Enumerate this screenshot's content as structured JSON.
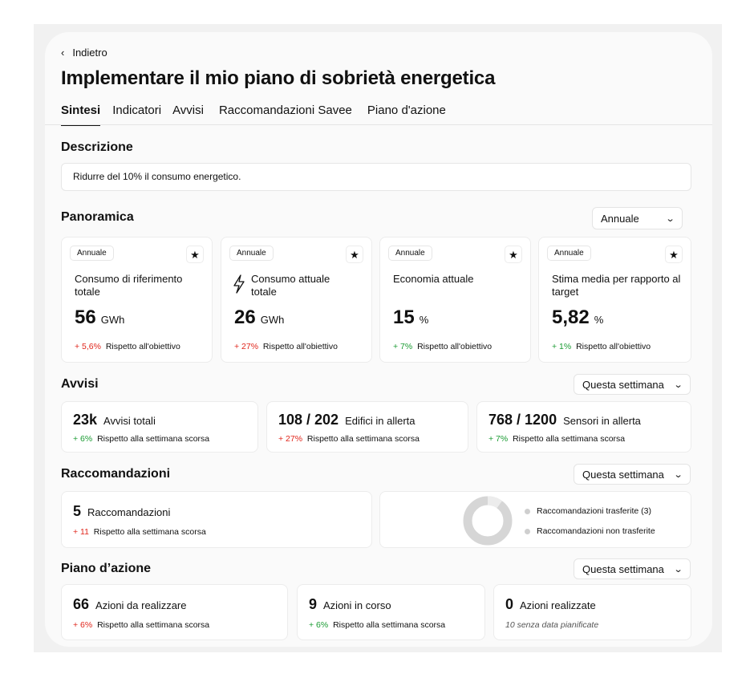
{
  "nav": {
    "back_label": "Indietro"
  },
  "page": {
    "title": "Implementare il mio piano di sobrietà energetica"
  },
  "tabs": [
    {
      "label": "Sintesi",
      "active": true
    },
    {
      "label": "Indicatori"
    },
    {
      "label": "Avvisi"
    },
    {
      "label": "Raccomandazioni Savee"
    },
    {
      "label": "Piano d'azione"
    }
  ],
  "description": {
    "heading": "Descrizione",
    "text": "Ridurre del 10% il consumo energetico."
  },
  "overview": {
    "heading": "Panoramica",
    "period_select": "Annuale",
    "cards": [
      {
        "badge": "Annuale",
        "label": "Consumo di riferimento totale",
        "value": "56",
        "unit": "GWh",
        "delta": "+ 5,6%",
        "delta_note": "Rispetto all'obiettivo",
        "icon": ""
      },
      {
        "badge": "Annuale",
        "label": "Consumo attuale totale",
        "value": "26",
        "unit": "GWh",
        "delta": "+ 27%",
        "delta_note": "Rispetto all'obiettivo",
        "icon": "lightning-icon"
      },
      {
        "badge": "Annuale",
        "label": "Economia attuale",
        "value": "15",
        "unit": "%",
        "delta": "+ 7%",
        "delta_note": "Rispetto all'obiettivo",
        "icon": ""
      },
      {
        "badge": "Annuale",
        "label": "Stima media per rapporto al target",
        "value": "5,82",
        "unit": "%",
        "delta": "+ 1%",
        "delta_note": "Rispetto all'obiettivo",
        "icon": ""
      }
    ]
  },
  "alerts": {
    "heading": "Avvisi",
    "period_select": "Questa settimana",
    "cards": [
      {
        "value": "23k",
        "label": "Avvisi totali",
        "delta": "+ 6%",
        "delta_note": "Rispetto alla settimana scorsa"
      },
      {
        "value": "108 / 202",
        "label": "Edifici in allerta",
        "delta": "+ 27%",
        "delta_note": "Rispetto alla settimana scorsa"
      },
      {
        "value": "768 / 1200",
        "label": "Sensori in allerta",
        "delta": "+ 7%",
        "delta_note": "Rispetto alla settimana scorsa"
      }
    ]
  },
  "recommendations": {
    "heading": "Raccomandazioni",
    "period_select": "Questa settimana",
    "count": {
      "value": "5",
      "label": "Raccomandazioni",
      "delta": "+ 11",
      "delta_note": "Rispetto alla settimana scorsa"
    },
    "donut": {
      "legend": [
        "Raccomandazioni trasferite (3)",
        "Raccomandazioni non trasferite"
      ]
    }
  },
  "action_plan": {
    "heading": "Piano d’azione",
    "period_select": "Questa settimana",
    "cards": [
      {
        "value": "66",
        "label": "Azioni da realizzare",
        "delta": "+ 6%",
        "delta_note": "Rispetto alla settimana scorsa"
      },
      {
        "value": "9",
        "label": "Azioni in corso",
        "delta": "+ 6%",
        "delta_note": "Rispetto alla settimana scorsa"
      },
      {
        "value": "0",
        "label": "Azioni realizzate",
        "note": "10 senza data pianificate"
      }
    ]
  },
  "colors": {
    "positive": "#1a9b32",
    "negative": "#e0251b",
    "accent": "#111111"
  }
}
